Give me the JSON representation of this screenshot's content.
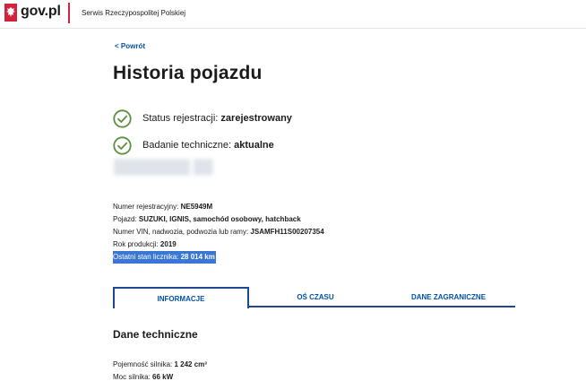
{
  "header": {
    "logo_text": "gov.pl",
    "service_name": "Serwis Rzeczypospolitej Polskiej"
  },
  "nav": {
    "back_label": "< Powrót"
  },
  "page": {
    "title": "Historia pojazdu"
  },
  "status": [
    {
      "label": "Status rejestracji: ",
      "value": "zarejestrowany"
    },
    {
      "label": "Badanie techniczne: ",
      "value": "aktualne"
    }
  ],
  "vehicle": {
    "registration_label": "Numer rejestracyjny: ",
    "registration_value": "NE5949M",
    "vehicle_label": "Pojazd: ",
    "vehicle_value": "SUZUKI, IGNIS, samochód osobowy, hatchback",
    "vin_label": "Numer VIN, nadwozia, podwozia lub ramy: ",
    "vin_value": "JSAMFH11S00207354",
    "year_label": "Rok produkcji: ",
    "year_value": "2019",
    "odometer_label": "Ostatni stan licznika: ",
    "odometer_value": "28 014 km"
  },
  "tabs": [
    {
      "label": "INFORMACJE",
      "active": true
    },
    {
      "label": "OŚ CZASU",
      "active": false
    },
    {
      "label": "DANE ZAGRANICZNE",
      "active": false
    }
  ],
  "technical": {
    "title": "Dane techniczne",
    "engine_capacity_label": "Pojemność silnika: ",
    "engine_capacity_value": "1 242 cm³",
    "engine_power_label": "Moc silnika: ",
    "engine_power_value": "66 kW"
  },
  "colors": {
    "accent_blue": "#0052a5",
    "tab_border": "#1b4a8e",
    "check_green": "#5e8e3e",
    "brand_red": "#d4213d",
    "selection": "#3a77d4"
  }
}
